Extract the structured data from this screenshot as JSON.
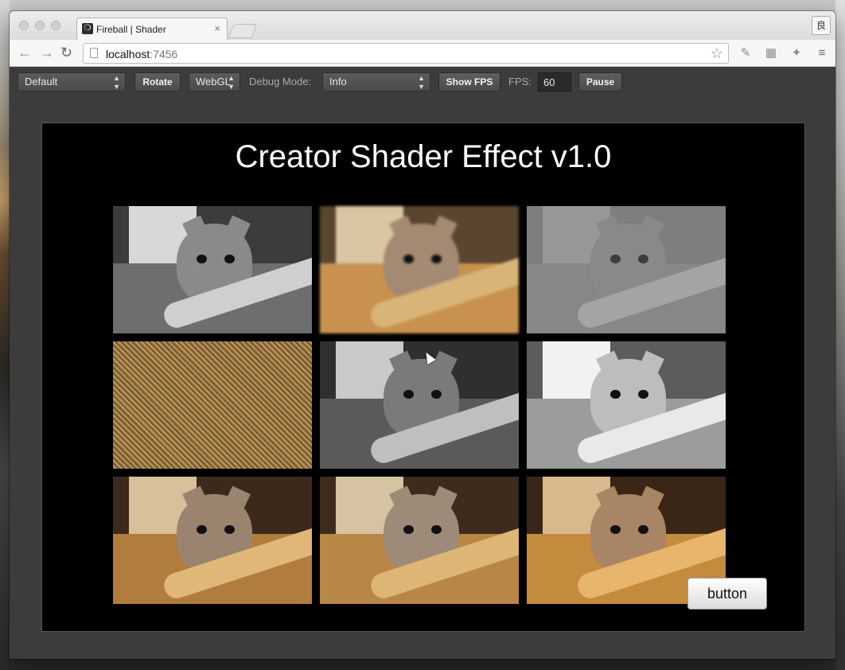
{
  "browser": {
    "tab_title": "Fireball | Shader",
    "tab_close": "×",
    "url_host": "localhost",
    "url_port": ":7456",
    "profile_label": "良"
  },
  "controls": {
    "device_select": "Default",
    "rotate_label": "Rotate",
    "renderer_select": "WebGL",
    "debug_mode_label": "Debug Mode:",
    "debug_mode_select": "Info",
    "show_fps_label": "Show FPS",
    "fps_label": "FPS:",
    "fps_value": "60",
    "pause_label": "Pause"
  },
  "scene": {
    "title": "Creator Shader Effect v1.0",
    "button_label": "button",
    "tiles": [
      {
        "effect": "grayscale",
        "colors": {
          "floor": "#6e6e6e",
          "door": "#d8d8d8",
          "cat": "#8a8a8a",
          "slide": "#cfcfcf",
          "bg": "#3c3c3c"
        }
      },
      {
        "effect": "blur",
        "colors": {
          "floor": "#c8924e",
          "door": "#d9c6a3",
          "cat": "#a48a73",
          "slide": "#d9b478",
          "bg": "#5a4530"
        }
      },
      {
        "effect": "emboss",
        "colors": {
          "floor": "#8c8c8c",
          "door": "#a9a9a9",
          "cat": "#8f8f8f",
          "slide": "#bdbdbd",
          "bg": "#7d7d7d"
        }
      },
      {
        "effect": "noise",
        "colors": {
          "floor": "#b98a44",
          "door": "#8a7354",
          "cat": "#7f6a50",
          "slide": "#a07a3f",
          "bg": "#6d5a44"
        }
      },
      {
        "effect": "grayscale-dark",
        "colors": {
          "floor": "#5a5a5a",
          "door": "#c9c9c9",
          "cat": "#7a7a7a",
          "slide": "#bfbfbf",
          "bg": "#2f2f2f"
        }
      },
      {
        "effect": "bright-gray",
        "colors": {
          "floor": "#9c9c9c",
          "door": "#f2f2f2",
          "cat": "#bdbdbd",
          "slide": "#e9e9e9",
          "bg": "#5c5c5c"
        }
      },
      {
        "effect": "wave",
        "colors": {
          "floor": "#b07d3e",
          "door": "#d7c09a",
          "cat": "#9a8470",
          "slide": "#e0b777",
          "bg": "#3b2a1c"
        }
      },
      {
        "effect": "normal",
        "colors": {
          "floor": "#b98745",
          "door": "#d6c3a1",
          "cat": "#9e8a78",
          "slide": "#ddb676",
          "bg": "#3d2b1d"
        }
      },
      {
        "effect": "warm",
        "colors": {
          "floor": "#c48a3e",
          "door": "#d8b88c",
          "cat": "#a88565",
          "slide": "#e8b56c",
          "bg": "#3a2616"
        }
      }
    ]
  }
}
